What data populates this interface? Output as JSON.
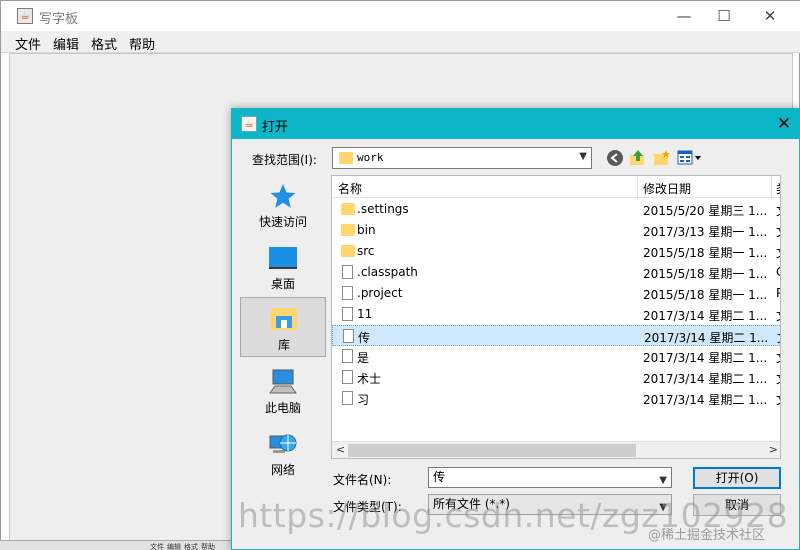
{
  "main_window": {
    "title": "写字板",
    "icon": "java-cup-icon",
    "controls": {
      "minimize": "—",
      "maximize": "☐",
      "close": "✕"
    },
    "menu": [
      "文件",
      "编辑",
      "格式",
      "帮助"
    ],
    "taskbar_menu": [
      "文件",
      "编辑",
      "格式",
      "帮助"
    ]
  },
  "dialog": {
    "title": "打开",
    "close": "✕",
    "look_in_label": "查找范围(I):",
    "look_in_value": "work",
    "places": [
      {
        "label": "快速访问",
        "icon": "star-icon"
      },
      {
        "label": "桌面",
        "icon": "desktop-icon"
      },
      {
        "label": "库",
        "icon": "library-icon"
      },
      {
        "label": "此电脑",
        "icon": "computer-icon"
      },
      {
        "label": "网络",
        "icon": "network-icon"
      }
    ],
    "columns": {
      "name": "名称",
      "modified": "修改日期",
      "extra": "类"
    },
    "files": [
      {
        "name": ".settings",
        "date": "2015/5/20 星期三 1...",
        "extra": "文",
        "kind": "folder"
      },
      {
        "name": "bin",
        "date": "2017/3/13 星期一 1...",
        "extra": "文",
        "kind": "folder"
      },
      {
        "name": "src",
        "date": "2015/5/18 星期一 1...",
        "extra": "文",
        "kind": "folder"
      },
      {
        "name": ".classpath",
        "date": "2015/5/18 星期一 1...",
        "extra": "C",
        "kind": "file"
      },
      {
        "name": ".project",
        "date": "2015/5/18 星期一 1...",
        "extra": "P",
        "kind": "file"
      },
      {
        "name": "11",
        "date": "2017/3/14 星期二 1...",
        "extra": "文",
        "kind": "file"
      },
      {
        "name": "传",
        "date": "2017/3/14 星期二 1...",
        "extra": "文",
        "kind": "file",
        "selected": true
      },
      {
        "name": "是",
        "date": "2017/3/14 星期二 1...",
        "extra": "文",
        "kind": "file"
      },
      {
        "name": "术士",
        "date": "2017/3/14 星期二 1...",
        "extra": "文",
        "kind": "file"
      },
      {
        "name": "习",
        "date": "2017/3/14 星期二 1...",
        "extra": "文",
        "kind": "file"
      }
    ],
    "file_name_label": "文件名(N):",
    "file_name_value": "传",
    "file_type_label": "文件类型(T):",
    "file_type_value": "所有文件 (*.*)",
    "open_button": "打开(O)",
    "cancel_button": "取消"
  },
  "watermark": {
    "url": "https://blog.csdn.net/zgz102928",
    "credit": "@稀土掘金技术社区"
  },
  "colors": {
    "dialog_title_bar": "#0db5c8",
    "selection": "#cfe8fc",
    "folder": "#ffd76e",
    "primary_border": "#0078d7"
  }
}
